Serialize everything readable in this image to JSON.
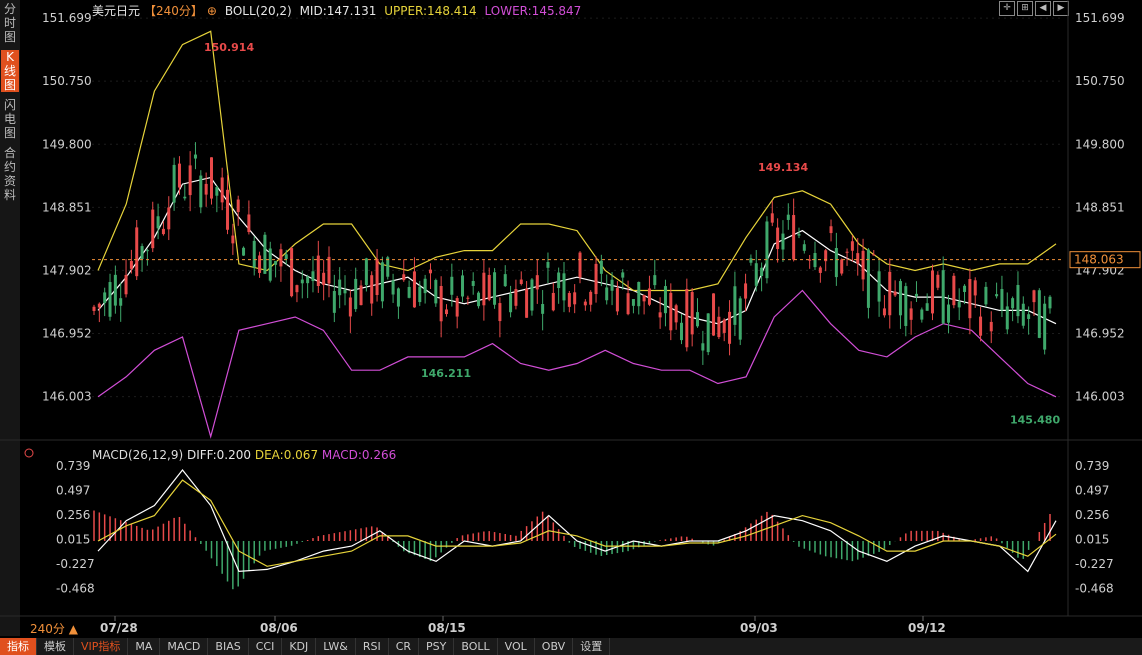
{
  "sidebar": {
    "tabs": [
      {
        "label": "分时图"
      },
      {
        "label": "K线图"
      },
      {
        "label": "闪电图"
      },
      {
        "label": "合约资料"
      }
    ]
  },
  "header": {
    "symbol": "美元日元",
    "period": "【240分】",
    "boll": "BOLL(20,2)",
    "mid": "MID:147.131",
    "upper": "UPPER:148.414",
    "lower": "LOWER:145.847"
  },
  "macd_header": {
    "name": "MACD(26,12,9)",
    "diff": "DIFF:0.200",
    "dea": "DEA:0.067",
    "macd": "MACD:0.266"
  },
  "period_selector": "240分 ▲",
  "toolbar": [
    "指标",
    "模板",
    "VIP指标",
    "MA",
    "MACD",
    "BIAS",
    "CCI",
    "KDJ",
    "LW&",
    "RSI",
    "CR",
    "PSY",
    "BOLL",
    "VOL",
    "OBV",
    "设置"
  ],
  "colors": {
    "up": "#e84a4a",
    "down": "#3fa86b",
    "mid": "#ffffff",
    "upper": "#e6d33a",
    "lower": "#d14ed6",
    "current": "#f0903a"
  },
  "chart_data": [
    {
      "type": "candlestick",
      "indicator": "BOLL(20,2)",
      "y_ticks": [
        "151.699",
        "150.750",
        "149.800",
        "148.851",
        "147.902",
        "146.952",
        "146.003"
      ],
      "ylim": [
        145.5,
        151.7
      ],
      "x_ticks": [
        "07/28",
        "08/06",
        "08/15",
        "09/03",
        "09/12"
      ],
      "current_price": "148.063",
      "annotations": [
        {
          "text": "150.914"
        },
        {
          "text": "146.211"
        },
        {
          "text": "149.134"
        },
        {
          "text": "145.480"
        }
      ],
      "series": [
        {
          "name": "MID",
          "values": [
            147.3,
            147.8,
            148.4,
            149.2,
            149.3,
            148.7,
            148.2,
            147.9,
            147.7,
            147.6,
            147.7,
            147.8,
            147.5,
            147.4,
            147.5,
            147.6,
            147.7,
            147.8,
            147.7,
            147.6,
            147.4,
            147.2,
            147.1,
            147.3,
            148.3,
            148.5,
            148.2,
            148.0,
            147.6,
            147.5,
            147.5,
            147.4,
            147.3,
            147.3,
            147.1
          ]
        },
        {
          "name": "UPPER",
          "values": [
            147.9,
            148.9,
            150.6,
            151.3,
            151.5,
            148.0,
            147.9,
            148.3,
            148.6,
            148.6,
            148.0,
            147.9,
            148.1,
            148.2,
            148.2,
            148.6,
            148.6,
            148.5,
            147.9,
            147.6,
            147.6,
            147.6,
            147.7,
            148.4,
            149.0,
            149.1,
            148.9,
            148.3,
            148.0,
            147.9,
            148.0,
            147.9,
            148.0,
            148.0,
            148.3
          ]
        },
        {
          "name": "LOWER",
          "values": [
            146.0,
            146.3,
            146.7,
            146.9,
            145.4,
            147.0,
            147.1,
            147.2,
            147.0,
            146.4,
            146.4,
            146.6,
            146.6,
            146.6,
            146.8,
            146.5,
            146.4,
            146.5,
            146.7,
            146.5,
            146.4,
            146.4,
            146.2,
            146.3,
            147.2,
            147.6,
            147.1,
            146.7,
            146.6,
            146.9,
            147.1,
            147.0,
            146.6,
            146.2,
            146.0
          ]
        }
      ]
    },
    {
      "type": "bar",
      "indicator": "MACD(26,12,9)",
      "y_ticks": [
        "0.739",
        "0.497",
        "0.256",
        "0.015",
        "-0.227",
        "-0.468"
      ],
      "ylim": [
        -0.7,
        0.739
      ],
      "series": [
        {
          "name": "DIFF",
          "values": [
            -0.1,
            0.2,
            0.35,
            0.7,
            0.35,
            -0.3,
            -0.28,
            -0.2,
            -0.1,
            -0.05,
            0.1,
            -0.1,
            -0.2,
            0.0,
            -0.05,
            0.0,
            0.25,
            0.0,
            -0.1,
            0.0,
            -0.05,
            0.0,
            0.0,
            0.1,
            0.25,
            0.2,
            0.1,
            -0.1,
            -0.2,
            -0.05,
            0.05,
            0.0,
            -0.05,
            -0.3,
            0.2
          ]
        },
        {
          "name": "DEA",
          "values": [
            0.0,
            0.15,
            0.25,
            0.6,
            0.4,
            -0.1,
            -0.25,
            -0.2,
            -0.15,
            -0.1,
            0.05,
            0.05,
            -0.05,
            -0.05,
            -0.05,
            -0.02,
            0.1,
            0.05,
            -0.05,
            -0.05,
            -0.05,
            -0.02,
            -0.02,
            0.05,
            0.15,
            0.25,
            0.18,
            0.05,
            -0.1,
            -0.1,
            0.0,
            0.0,
            -0.05,
            -0.15,
            0.067
          ]
        },
        {
          "name": "MACD",
          "values": [
            0.3,
            0.2,
            0.1,
            0.25,
            -0.1,
            -0.5,
            -0.1,
            -0.05,
            0.05,
            0.1,
            0.15,
            -0.1,
            -0.2,
            0.05,
            0.1,
            0.05,
            0.3,
            -0.05,
            -0.15,
            -0.1,
            0.0,
            0.05,
            -0.05,
            0.1,
            0.3,
            -0.05,
            -0.15,
            -0.2,
            -0.1,
            0.1,
            0.1,
            0.0,
            0.05,
            -0.2,
            0.266
          ]
        }
      ]
    }
  ]
}
